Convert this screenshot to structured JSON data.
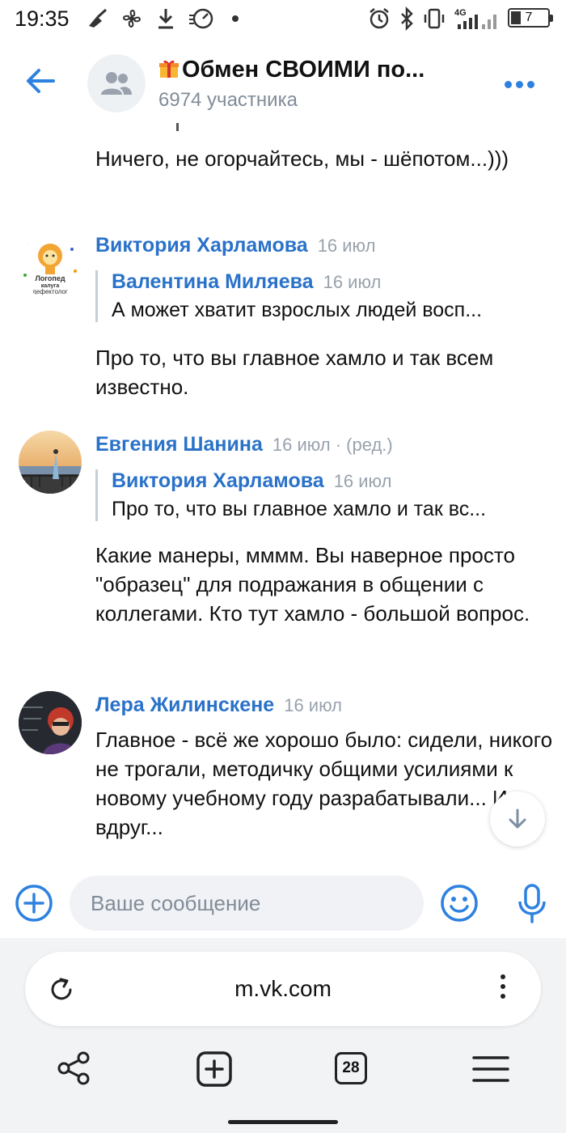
{
  "status_bar": {
    "time": "19:35",
    "network_label": "4G",
    "battery": "7",
    "icons": [
      "broom-icon",
      "fan-icon",
      "download-icon",
      "speedometer-icon",
      "dot-icon",
      "alarm-icon",
      "bluetooth-icon",
      "vibrate-icon",
      "signal-icon",
      "battery-icon"
    ]
  },
  "header": {
    "title": "Обмен СВОИМИ по...",
    "subtitle": "6974 участника"
  },
  "messages": [
    {
      "text": "Ничего, не огорчайтесь, мы - шёпотом...)))"
    },
    {
      "author": "Виктория Харламова",
      "date": "16 июл",
      "avatar_text": [
        "Логопед",
        "калуга",
        "дефектолог"
      ],
      "quote": {
        "author": "Валентина Миляева",
        "date": "16 июл",
        "text": "А может хватит взрослых людей восп..."
      },
      "text": "Про то, что вы главное хамло и так всем известно."
    },
    {
      "author": "Евгения Шанина",
      "date": "16 июл · (ред.)",
      "quote": {
        "author": "Виктория Харламова",
        "date": "16 июл",
        "text": "Про то, что вы главное хамло и так вс..."
      },
      "text": "Какие манеры, мммм. Вы наверное просто \"образец\" для подражания в общении с коллегами. Кто тут хамло - большой вопрос."
    },
    {
      "author": "Лера Жилинскене",
      "date": "16 июл",
      "text": "Главное - всё же хорошо было: сидели, никого не трогали, методичку общими усилиями к новому учебному году разрабатывали... И вдруг..."
    }
  ],
  "composer": {
    "placeholder": "Ваше сообщение"
  },
  "browser": {
    "url": "m.vk.com",
    "tabs_count": "28"
  },
  "colors": {
    "accent": "#2d81e0",
    "link": "#2a72c9",
    "secondary_text": "#818c99"
  }
}
